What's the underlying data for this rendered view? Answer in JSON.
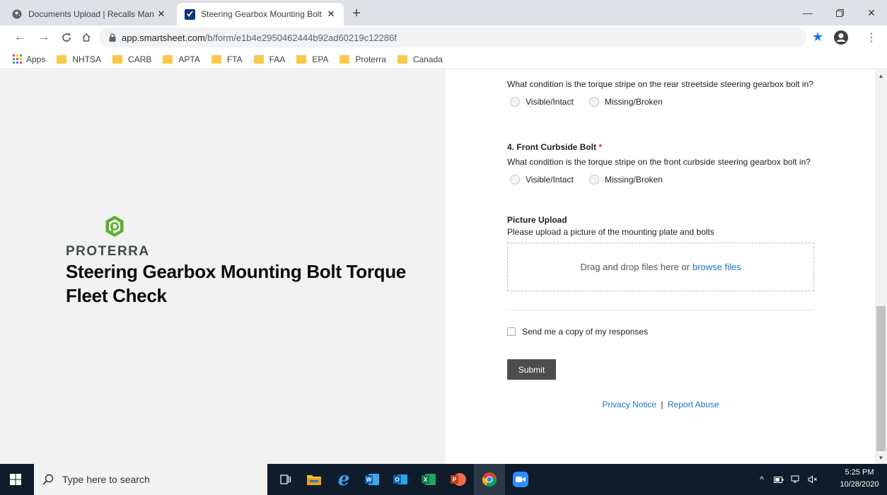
{
  "browser": {
    "tabs": [
      {
        "title": "Documents Upload | Recalls Man",
        "active": false
      },
      {
        "title": "Steering Gearbox Mounting Bolt",
        "active": true
      }
    ],
    "url_host": "app.smartsheet.com",
    "url_path": "/b/form/e1b4e2950462444b92ad60219c12286f",
    "bookmarks": [
      "Apps",
      "NHTSA",
      "CARB",
      "APTA",
      "FTA",
      "FAA",
      "EPA",
      "Proterra",
      "Canada"
    ],
    "colors": {
      "accent": "#1a73e8",
      "folder": "#f9c94a"
    }
  },
  "brand": {
    "name": "PROTERRA",
    "form_title": "Steering Gearbox Mounting Bolt Torque Fleet Check",
    "logo_color": "#5bb02e"
  },
  "form": {
    "q3": {
      "question": "What condition is the torque stripe on the rear streetside steering gearbox bolt in?",
      "options": [
        "Visible/Intact",
        "Missing/Broken"
      ]
    },
    "q4": {
      "label": "4. Front Curbside Bolt",
      "required_mark": "*",
      "question": "What condition is the torque stripe on the front curbside steering gearbox bolt in?",
      "options": [
        "Visible/Intact",
        "Missing/Broken"
      ]
    },
    "upload": {
      "label": "Picture Upload",
      "description": "Please upload a picture of the mounting plate and bolts",
      "drop_text": "Drag and drop files here or",
      "browse_link": "browse files"
    },
    "send_copy_label": "Send me a copy of my responses",
    "submit_label": "Submit",
    "footer": {
      "privacy": "Privacy Notice",
      "separator": "|",
      "abuse": "Report Abuse"
    },
    "colors": {
      "link": "#1a73c8",
      "required": "#d0342c",
      "submit_bg": "#4d4d4d"
    }
  },
  "taskbar": {
    "search_placeholder": "Type here to search",
    "time": "5:25 PM",
    "date": "10/28/2020",
    "apps": [
      "task-view",
      "file-explorer",
      "internet-explorer",
      "word",
      "outlook",
      "excel",
      "powerpoint",
      "chrome",
      "zoom"
    ]
  }
}
